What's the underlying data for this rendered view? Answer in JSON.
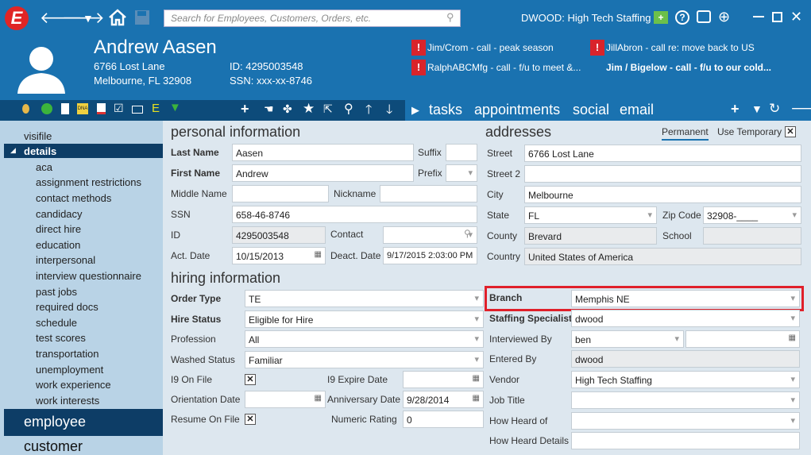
{
  "app": {
    "search_placeholder": "Search for Employees, Customers, Orders, etc.",
    "user_label": "DWOOD: High Tech Staffing",
    "logo_letter": "E"
  },
  "profile": {
    "name": "Andrew Aasen",
    "address1": "6766 Lost Lane",
    "address2": "Melbourne, FL 32908",
    "id": "ID: 4295003548",
    "ssn": "SSN: xxx-xx-8746"
  },
  "notes": [
    "Jim/Crom - call - peak season",
    "JillAbron - call re: move back to US",
    "RalphABCMfg - call - f/u to meet &...",
    "Jim / Bigelow - call - f/u to our cold..."
  ],
  "tabs": [
    "tasks",
    "appointments",
    "social",
    "email"
  ],
  "sidebar": {
    "visifile": "visifile",
    "details": "details",
    "items": [
      "aca",
      "assignment restrictions",
      "contact methods",
      "candidacy",
      "direct hire",
      "education",
      "interpersonal",
      "interview questionnaire",
      "past jobs",
      "required docs",
      "schedule",
      "test scores",
      "transportation",
      "unemployment",
      "work experience",
      "work interests"
    ],
    "employee": "employee",
    "customer": "customer"
  },
  "personal": {
    "title": "personal information",
    "last_name_label": "Last Name",
    "last_name": "Aasen",
    "suffix_label": "Suffix",
    "first_name_label": "First Name",
    "first_name": "Andrew",
    "prefix_label": "Prefix",
    "middle_label": "Middle Name",
    "nickname_label": "Nickname",
    "ssn_label": "SSN",
    "ssn": "658-46-8746",
    "id_label": "ID",
    "id": "4295003548",
    "contact_label": "Contact",
    "act_label": "Act. Date",
    "act": "10/15/2013",
    "deact_label": "Deact. Date",
    "deact": "9/17/2015 2:03:00 PM"
  },
  "addresses": {
    "title": "addresses",
    "permanent": "Permanent",
    "temporary": "Use Temporary",
    "street_label": "Street",
    "street": "6766 Lost Lane",
    "street2_label": "Street 2",
    "city_label": "City",
    "city": "Melbourne",
    "state_label": "State",
    "state": "FL",
    "zip_label": "Zip Code",
    "zip": "32908-____",
    "county_label": "County",
    "county": "Brevard",
    "school_label": "School",
    "country_label": "Country",
    "country": "United States of America"
  },
  "hiring": {
    "title": "hiring information",
    "order_type_label": "Order Type",
    "order_type": "TE",
    "hire_status_label": "Hire Status",
    "hire_status": "Eligible for Hire",
    "profession_label": "Profession",
    "profession": "All",
    "washed_label": "Washed Status",
    "washed": "Familiar",
    "i9_label": "I9 On File",
    "i9_expire_label": "I9 Expire Date",
    "orientation_label": "Orientation Date",
    "anniversary_label": "Anniversary Date",
    "anniversary": "9/28/2014",
    "resume_label": "Resume On File",
    "rating_label": "Numeric Rating",
    "rating": "0",
    "branch_label": "Branch",
    "branch": "Memphis NE",
    "specialist_label": "Staffing Specialist",
    "specialist": "dwood",
    "interviewed_label": "Interviewed By",
    "interviewed": "ben",
    "entered_label": "Entered By",
    "entered": "dwood",
    "vendor_label": "Vendor",
    "vendor": "High Tech Staffing",
    "job_title_label": "Job Title",
    "heard_label": "How Heard of",
    "heard_details_label": "How Heard Details",
    "check": "✕"
  }
}
